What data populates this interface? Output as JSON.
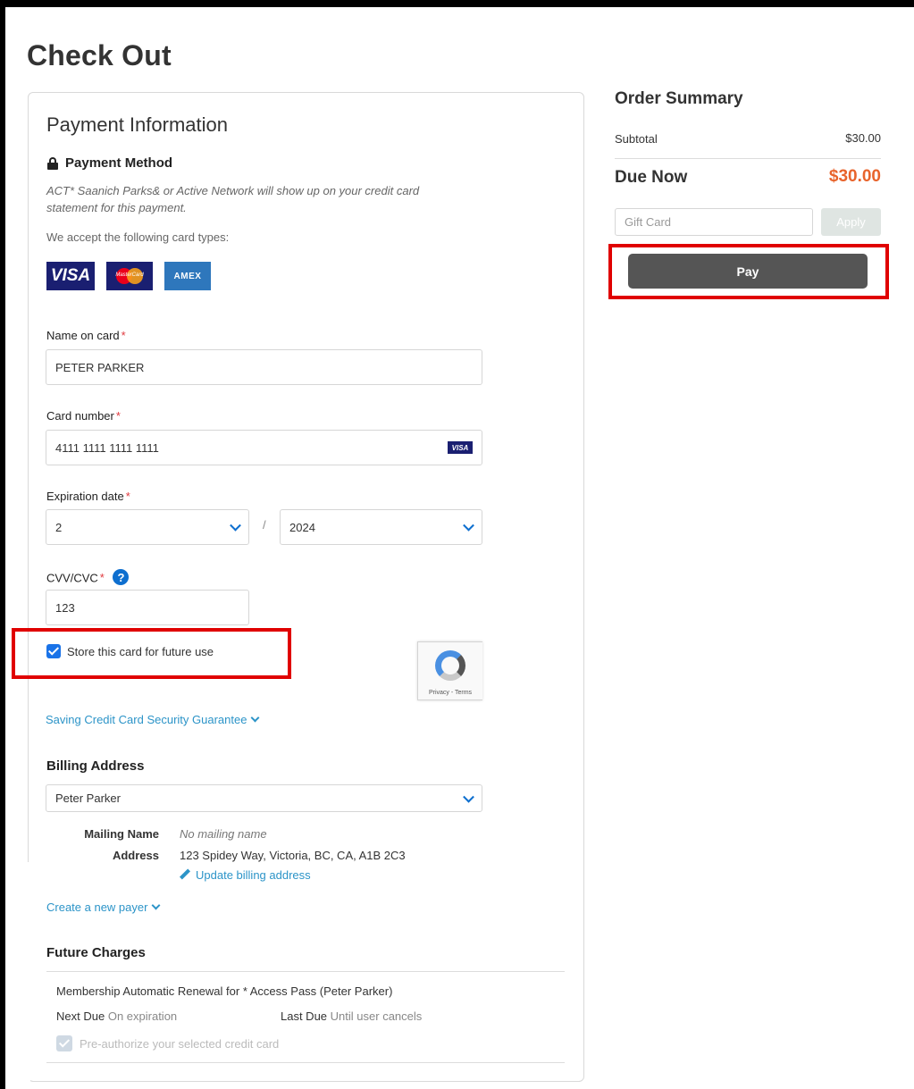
{
  "page": {
    "title": "Check Out"
  },
  "payment": {
    "title": "Payment Information",
    "method_title": "Payment Method",
    "statement_note": "ACT* Saanich Parks& or Active Network will show up on your credit card statement for this payment.",
    "accept_text": "We accept the following card types:",
    "card_types": [
      "VISA",
      "MasterCard",
      "AMEX"
    ],
    "name_label": "Name on card",
    "name_value": "PETER PARKER",
    "card_label": "Card number",
    "card_value": "4111 1111 1111 1111",
    "card_brand": "VISA",
    "exp_label": "Expiration date",
    "exp_month": "2",
    "exp_separator": "/",
    "exp_year": "2024",
    "cvv_label": "CVV/CVC",
    "cvv_help": "?",
    "cvv_value": "123",
    "required_mark": "*",
    "store_card_label": "Store this card for future use",
    "store_card_checked": true,
    "recaptcha_text": "Privacy - Terms",
    "security_link": "Saving Credit Card Security Guarantee"
  },
  "billing": {
    "title": "Billing Address",
    "selected_payer": "Peter Parker",
    "mailing_name_label": "Mailing Name",
    "mailing_name_value": "No mailing name",
    "address_label": "Address",
    "address_value": "123 Spidey Way, Victoria, BC, CA, A1B 2C3",
    "update_link": "Update billing address",
    "new_payer_link": "Create a new payer"
  },
  "future": {
    "title": "Future Charges",
    "item": "Membership Automatic Renewal for * Access Pass (Peter Parker)",
    "next_due_label": "Next Due",
    "next_due_value": "On expiration",
    "last_due_label": "Last Due",
    "last_due_value": "Until user cancels",
    "preauth_label": "Pre-authorize your selected credit card"
  },
  "summary": {
    "title": "Order Summary",
    "subtotal_label": "Subtotal",
    "subtotal_value": "$30.00",
    "due_label": "Due Now",
    "due_value": "$30.00",
    "gift_placeholder": "Gift Card",
    "apply_label": "Apply",
    "pay_label": "Pay"
  },
  "colors": {
    "accent": "#2c94c8",
    "due_amount": "#e8642c",
    "pay_button": "#555555",
    "highlight_box": "#e00000"
  }
}
